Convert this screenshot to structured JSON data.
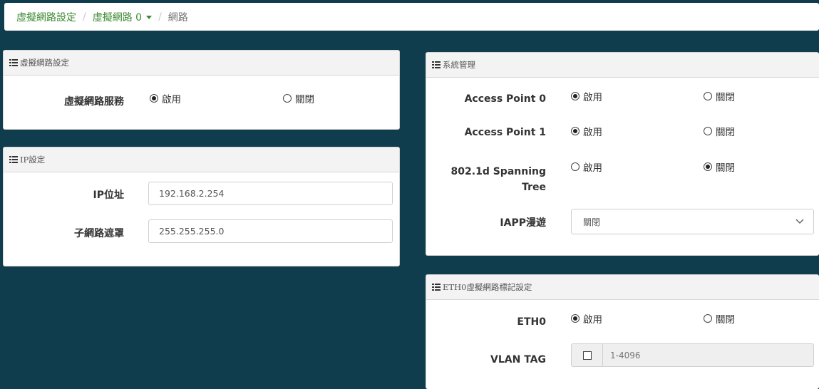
{
  "breadcrumb": {
    "item1": "虛擬網路設定",
    "item2": "虛擬網路 0",
    "item3": "網路",
    "separator": "/"
  },
  "vlan_settings": {
    "title": "虛擬網路設定",
    "service_label": "虛擬網路服務",
    "enable_label": "啟用",
    "disable_label": "關閉",
    "selected": "enable"
  },
  "ip_settings": {
    "title": "IP設定",
    "ip_label": "IP位址",
    "ip_value": "192.168.2.254",
    "mask_label": "子網路遮罩",
    "mask_value": "255.255.255.0"
  },
  "system_management": {
    "title": "系統管理",
    "rows": [
      {
        "label": "Access Point 0",
        "enable": "啟用",
        "disable": "關閉",
        "selected": "enable"
      },
      {
        "label": "Access Point 1",
        "enable": "啟用",
        "disable": "關閉",
        "selected": "enable"
      },
      {
        "label_line1": "802.1d Spanning",
        "label_line2": "Tree",
        "enable": "啟用",
        "disable": "關閉",
        "selected": "disable"
      }
    ],
    "iapp_label": "IAPP漫遊",
    "iapp_value": "關閉"
  },
  "eth0_tag": {
    "title": "ETH0虛擬網路標記設定",
    "eth0_label": "ETH0",
    "enable_label": "啟用",
    "disable_label": "關閉",
    "selected": "enable",
    "vlan_label": "VLAN TAG",
    "vlan_checked": false,
    "vlan_placeholder": "1-4096"
  },
  "icons": {
    "panel_heading": "list-icon",
    "select": "chevron-down-icon"
  },
  "colors": {
    "background": "#0f3d4d",
    "breadcrumb_link": "#3c8b33"
  }
}
